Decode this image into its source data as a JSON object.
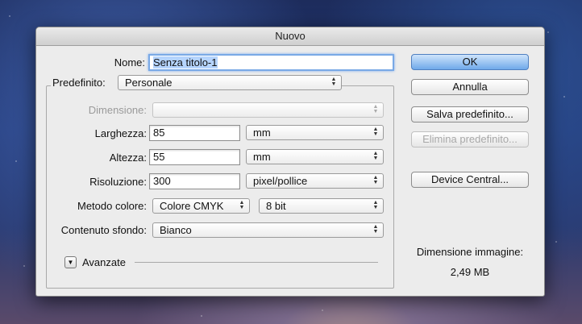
{
  "window": {
    "title": "Nuovo"
  },
  "form": {
    "name_label": "Nome:",
    "name_value": "Senza titolo-1",
    "preset_label": "Predefinito:",
    "preset_value": "Personale",
    "size_label": "Dimensione:",
    "size_value": "",
    "width_label": "Larghezza:",
    "width_value": "85",
    "width_unit": "mm",
    "height_label": "Altezza:",
    "height_value": "55",
    "height_unit": "mm",
    "resolution_label": "Risoluzione:",
    "resolution_value": "300",
    "resolution_unit": "pixel/pollice",
    "color_mode_label": "Metodo colore:",
    "color_mode_value": "Colore CMYK",
    "bit_depth_value": "8 bit",
    "background_label": "Contenuto sfondo:",
    "background_value": "Bianco",
    "advanced_label": "Avanzate"
  },
  "buttons": {
    "ok": "OK",
    "cancel": "Annulla",
    "save_preset": "Salva predefinito...",
    "delete_preset": "Elimina predefinito...",
    "device_central": "Device Central..."
  },
  "info": {
    "image_size_label": "Dimensione immagine:",
    "image_size_value": "2,49 MB"
  },
  "icons": {
    "select_arrows": "updown-arrows-icon",
    "disclosure": "triangle-down-icon"
  }
}
